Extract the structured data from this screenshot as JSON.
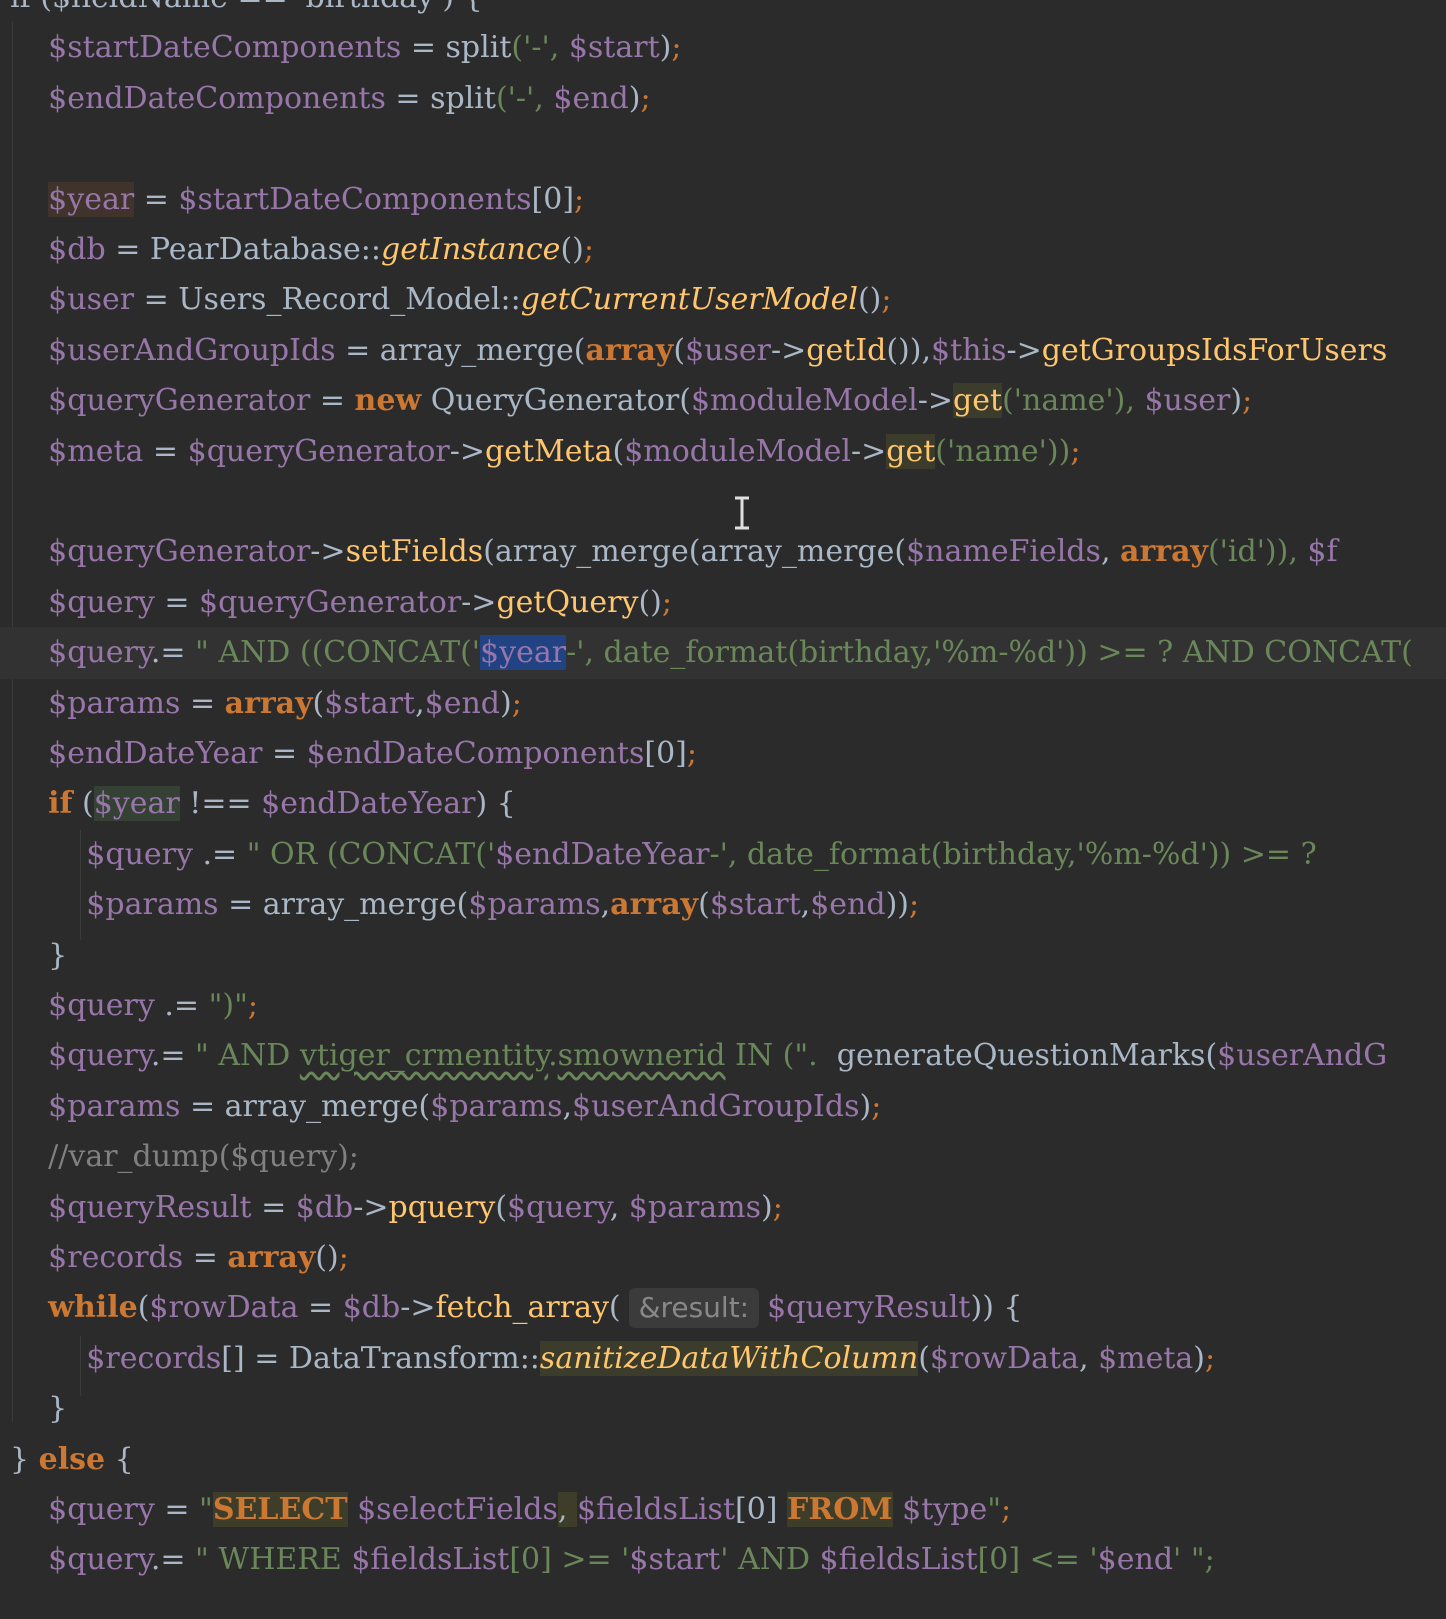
{
  "editor": {
    "theme": "darcula",
    "background": "#2b2b2b",
    "lines": [
      [
        {
          "t": "if ($fieldName == 'birthday') {",
          "c": "op"
        }
      ],
      [
        {
          "t": "    "
        },
        {
          "t": "$startDateComponents",
          "c": "v"
        },
        {
          "t": " = ",
          "c": "op"
        },
        {
          "t": "split",
          "c": "op"
        },
        {
          "t": "('-', ",
          "c": "st"
        },
        {
          "t": "$start",
          "c": "v"
        },
        {
          "t": ")",
          "c": "op"
        },
        {
          "t": ";",
          "c": "semi"
        }
      ],
      [
        {
          "t": "    "
        },
        {
          "t": "$endDateComponents",
          "c": "v"
        },
        {
          "t": " = ",
          "c": "op"
        },
        {
          "t": "split",
          "c": "op"
        },
        {
          "t": "('-', ",
          "c": "st"
        },
        {
          "t": "$end",
          "c": "v"
        },
        {
          "t": ")",
          "c": "op"
        },
        {
          "t": ";",
          "c": "semi"
        }
      ],
      [
        {
          "t": ""
        }
      ],
      [
        {
          "t": "    "
        },
        {
          "t": "$year",
          "c": "v hl-write"
        },
        {
          "t": " = ",
          "c": "op"
        },
        {
          "t": "$startDateComponents",
          "c": "v"
        },
        {
          "t": "[0]",
          "c": "op"
        },
        {
          "t": ";",
          "c": "semi"
        }
      ],
      [
        {
          "t": "    "
        },
        {
          "t": "$db",
          "c": "v"
        },
        {
          "t": " = PearDatabase::",
          "c": "op"
        },
        {
          "t": "getInstance",
          "c": "it"
        },
        {
          "t": "()",
          "c": "op"
        },
        {
          "t": ";",
          "c": "semi"
        }
      ],
      [
        {
          "t": "    "
        },
        {
          "t": "$user",
          "c": "v"
        },
        {
          "t": " = Users_Record_Model::",
          "c": "op"
        },
        {
          "t": "getCurrentUserModel",
          "c": "it"
        },
        {
          "t": "()",
          "c": "op"
        },
        {
          "t": ";",
          "c": "semi"
        }
      ],
      [
        {
          "t": "    "
        },
        {
          "t": "$userAndGroupIds",
          "c": "v"
        },
        {
          "t": " = array_merge(",
          "c": "op"
        },
        {
          "t": "array",
          "c": "kw"
        },
        {
          "t": "(",
          "c": "op"
        },
        {
          "t": "$user",
          "c": "v"
        },
        {
          "t": "->",
          "c": "op"
        },
        {
          "t": "getId",
          "c": "fn"
        },
        {
          "t": "()),",
          "c": "op"
        },
        {
          "t": "$this",
          "c": "v"
        },
        {
          "t": "->",
          "c": "op"
        },
        {
          "t": "getGroupsIdsForUsers",
          "c": "fn"
        }
      ],
      [
        {
          "t": "    "
        },
        {
          "t": "$queryGenerator",
          "c": "v"
        },
        {
          "t": " = ",
          "c": "op"
        },
        {
          "t": "new",
          "c": "kw"
        },
        {
          "t": " QueryGenerator(",
          "c": "op"
        },
        {
          "t": "$moduleModel",
          "c": "v"
        },
        {
          "t": "->",
          "c": "op"
        },
        {
          "t": "get",
          "c": "fn hl-match"
        },
        {
          "t": "('name'), ",
          "c": "st"
        },
        {
          "t": "$user",
          "c": "v"
        },
        {
          "t": ")",
          "c": "op"
        },
        {
          "t": ";",
          "c": "semi"
        }
      ],
      [
        {
          "t": "    "
        },
        {
          "t": "$meta",
          "c": "v"
        },
        {
          "t": " = ",
          "c": "op"
        },
        {
          "t": "$queryGenerator",
          "c": "v"
        },
        {
          "t": "->",
          "c": "op"
        },
        {
          "t": "getMeta",
          "c": "fn"
        },
        {
          "t": "(",
          "c": "op"
        },
        {
          "t": "$moduleModel",
          "c": "v"
        },
        {
          "t": "->",
          "c": "op"
        },
        {
          "t": "get",
          "c": "fn hl-match"
        },
        {
          "t": "('name'))",
          "c": "st"
        },
        {
          "t": ";",
          "c": "semi"
        }
      ],
      [
        {
          "t": ""
        }
      ],
      [
        {
          "t": "    "
        },
        {
          "t": "$queryGenerator",
          "c": "v"
        },
        {
          "t": "->",
          "c": "op"
        },
        {
          "t": "setFields",
          "c": "fn"
        },
        {
          "t": "(array_merge(array_merge(",
          "c": "op"
        },
        {
          "t": "$nameFields",
          "c": "v"
        },
        {
          "t": ", ",
          "c": "op"
        },
        {
          "t": "array",
          "c": "kw"
        },
        {
          "t": "('id')), ",
          "c": "st"
        },
        {
          "t": "$f",
          "c": "v"
        }
      ],
      [
        {
          "t": "    "
        },
        {
          "t": "$query",
          "c": "v"
        },
        {
          "t": " = ",
          "c": "op"
        },
        {
          "t": "$queryGenerator",
          "c": "v"
        },
        {
          "t": "->",
          "c": "op"
        },
        {
          "t": "getQuery",
          "c": "fn"
        },
        {
          "t": "()",
          "c": "op"
        },
        {
          "t": ";",
          "c": "semi"
        }
      ],
      [
        {
          "t": "    "
        },
        {
          "t": "$query",
          "c": "v"
        },
        {
          "t": ".= ",
          "c": "op"
        },
        {
          "t": "\" AND ((CONCAT('",
          "c": "st"
        },
        {
          "t": "$year",
          "c": "v hl-sel"
        },
        {
          "t": "-', date_format(birthday,'%m-%d')) >= ? AND CONCAT(",
          "c": "st"
        }
      ],
      [
        {
          "t": "    "
        },
        {
          "t": "$params",
          "c": "v"
        },
        {
          "t": " = ",
          "c": "op"
        },
        {
          "t": "array",
          "c": "kw"
        },
        {
          "t": "(",
          "c": "op"
        },
        {
          "t": "$start",
          "c": "v"
        },
        {
          "t": ",",
          "c": "op"
        },
        {
          "t": "$end",
          "c": "v"
        },
        {
          "t": ")",
          "c": "op"
        },
        {
          "t": ";",
          "c": "semi"
        }
      ],
      [
        {
          "t": "    "
        },
        {
          "t": "$endDateYear",
          "c": "v"
        },
        {
          "t": " = ",
          "c": "op"
        },
        {
          "t": "$endDateComponents",
          "c": "v"
        },
        {
          "t": "[0]",
          "c": "op"
        },
        {
          "t": ";",
          "c": "semi"
        }
      ],
      [
        {
          "t": "    "
        },
        {
          "t": "if",
          "c": "kw"
        },
        {
          "t": " (",
          "c": "op"
        },
        {
          "t": "$year",
          "c": "v hl-read"
        },
        {
          "t": " !== ",
          "c": "op"
        },
        {
          "t": "$endDateYear",
          "c": "v"
        },
        {
          "t": ") {",
          "c": "op"
        }
      ],
      [
        {
          "t": "        "
        },
        {
          "t": "$query",
          "c": "v"
        },
        {
          "t": " .= ",
          "c": "op"
        },
        {
          "t": "\" OR (CONCAT('",
          "c": "st"
        },
        {
          "t": "$endDateYear",
          "c": "v"
        },
        {
          "t": "-', date_format(birthday,'%m-%d')) >= ?",
          "c": "st"
        }
      ],
      [
        {
          "t": "        "
        },
        {
          "t": "$params",
          "c": "v"
        },
        {
          "t": " = array_merge(",
          "c": "op"
        },
        {
          "t": "$params",
          "c": "v"
        },
        {
          "t": ",",
          "c": "op"
        },
        {
          "t": "array",
          "c": "kw"
        },
        {
          "t": "(",
          "c": "op"
        },
        {
          "t": "$start",
          "c": "v"
        },
        {
          "t": ",",
          "c": "op"
        },
        {
          "t": "$end",
          "c": "v"
        },
        {
          "t": "))",
          "c": "op"
        },
        {
          "t": ";",
          "c": "semi"
        }
      ],
      [
        {
          "t": "    }",
          "c": "op"
        }
      ],
      [
        {
          "t": "    "
        },
        {
          "t": "$query",
          "c": "v"
        },
        {
          "t": " .= ",
          "c": "op"
        },
        {
          "t": "\")\"",
          "c": "st"
        },
        {
          "t": ";",
          "c": "semi"
        }
      ],
      [
        {
          "t": "    "
        },
        {
          "t": "$query",
          "c": "v"
        },
        {
          "t": ".= ",
          "c": "op"
        },
        {
          "t": "\" AND ",
          "c": "st"
        },
        {
          "t": "vtiger_crmentity",
          "c": "st wavy"
        },
        {
          "t": ".",
          "c": "st"
        },
        {
          "t": "smownerid",
          "c": "st wavy"
        },
        {
          "t": " IN (\". ",
          "c": "st"
        },
        {
          "t": " generateQuestionMarks(",
          "c": "op"
        },
        {
          "t": "$userAndG",
          "c": "v"
        }
      ],
      [
        {
          "t": "    "
        },
        {
          "t": "$params",
          "c": "v"
        },
        {
          "t": " = array_merge(",
          "c": "op"
        },
        {
          "t": "$params",
          "c": "v"
        },
        {
          "t": ",",
          "c": "op"
        },
        {
          "t": "$userAndGroupIds",
          "c": "v"
        },
        {
          "t": ")",
          "c": "op"
        },
        {
          "t": ";",
          "c": "semi"
        }
      ],
      [
        {
          "t": "    "
        },
        {
          "t": "//var_dump($query);",
          "c": "cm"
        }
      ],
      [
        {
          "t": "    "
        },
        {
          "t": "$queryResult",
          "c": "v"
        },
        {
          "t": " = ",
          "c": "op"
        },
        {
          "t": "$db",
          "c": "v"
        },
        {
          "t": "->",
          "c": "op"
        },
        {
          "t": "pquery",
          "c": "fn"
        },
        {
          "t": "(",
          "c": "op"
        },
        {
          "t": "$query",
          "c": "v"
        },
        {
          "t": ", ",
          "c": "op"
        },
        {
          "t": "$params",
          "c": "v"
        },
        {
          "t": ")",
          "c": "op"
        },
        {
          "t": ";",
          "c": "semi"
        }
      ],
      [
        {
          "t": "    "
        },
        {
          "t": "$records",
          "c": "v"
        },
        {
          "t": " = ",
          "c": "op"
        },
        {
          "t": "array",
          "c": "kw"
        },
        {
          "t": "()",
          "c": "op"
        },
        {
          "t": ";",
          "c": "semi"
        }
      ],
      [
        {
          "t": "    "
        },
        {
          "t": "while",
          "c": "kw"
        },
        {
          "t": "(",
          "c": "op"
        },
        {
          "t": "$rowData",
          "c": "v"
        },
        {
          "t": " = ",
          "c": "op"
        },
        {
          "t": "$db",
          "c": "v"
        },
        {
          "t": "->",
          "c": "op"
        },
        {
          "t": "fetch_array",
          "c": "fn"
        },
        {
          "t": "(",
          "c": "op"
        },
        {
          "t": "&result:",
          "c": "hint"
        },
        {
          "t": "$queryResult",
          "c": "v"
        },
        {
          "t": ")) {",
          "c": "op"
        }
      ],
      [
        {
          "t": "        "
        },
        {
          "t": "$records",
          "c": "v"
        },
        {
          "t": "[] = DataTransform::",
          "c": "op"
        },
        {
          "t": "sanitizeDataWithColumn",
          "c": "it hl-match"
        },
        {
          "t": "(",
          "c": "op"
        },
        {
          "t": "$rowData",
          "c": "v"
        },
        {
          "t": ", ",
          "c": "op"
        },
        {
          "t": "$meta",
          "c": "v"
        },
        {
          "t": ")",
          "c": "op"
        },
        {
          "t": ";",
          "c": "semi"
        }
      ],
      [
        {
          "t": "    }",
          "c": "op"
        }
      ],
      [
        {
          "t": "} ",
          "c": "op"
        },
        {
          "t": "else",
          "c": "kw"
        },
        {
          "t": " {",
          "c": "op"
        }
      ],
      [
        {
          "t": "    "
        },
        {
          "t": "$query",
          "c": "v"
        },
        {
          "t": " = ",
          "c": "op"
        },
        {
          "t": "\"",
          "c": "st"
        },
        {
          "t": "SELECT",
          "c": "kw hl-sql"
        },
        {
          "t": " "
        },
        {
          "t": "$selectFields",
          "c": "v"
        },
        {
          "t": ", ",
          "c": "op hl-sql"
        },
        {
          "t": "$fieldsList",
          "c": "v"
        },
        {
          "t": "[0] ",
          "c": "op"
        },
        {
          "t": "FROM",
          "c": "kw hl-sql"
        },
        {
          "t": " "
        },
        {
          "t": "$type",
          "c": "v"
        },
        {
          "t": "\"",
          "c": "st"
        },
        {
          "t": ";",
          "c": "semi"
        }
      ],
      [
        {
          "t": "    "
        },
        {
          "t": "$query",
          "c": "v"
        },
        {
          "t": ".= ",
          "c": "op"
        },
        {
          "t": "\" WHERE ",
          "c": "st"
        },
        {
          "t": "$fieldsList",
          "c": "v"
        },
        {
          "t": "[0] >= '",
          "c": "st"
        },
        {
          "t": "$start",
          "c": "v"
        },
        {
          "t": "' AND ",
          "c": "st"
        },
        {
          "t": "$fieldsList",
          "c": "v"
        },
        {
          "t": "[0] <= '",
          "c": "st"
        },
        {
          "t": "$end",
          "c": "v"
        },
        {
          "t": "' \";",
          "c": "st"
        }
      ]
    ],
    "current_line_index": 13
  }
}
